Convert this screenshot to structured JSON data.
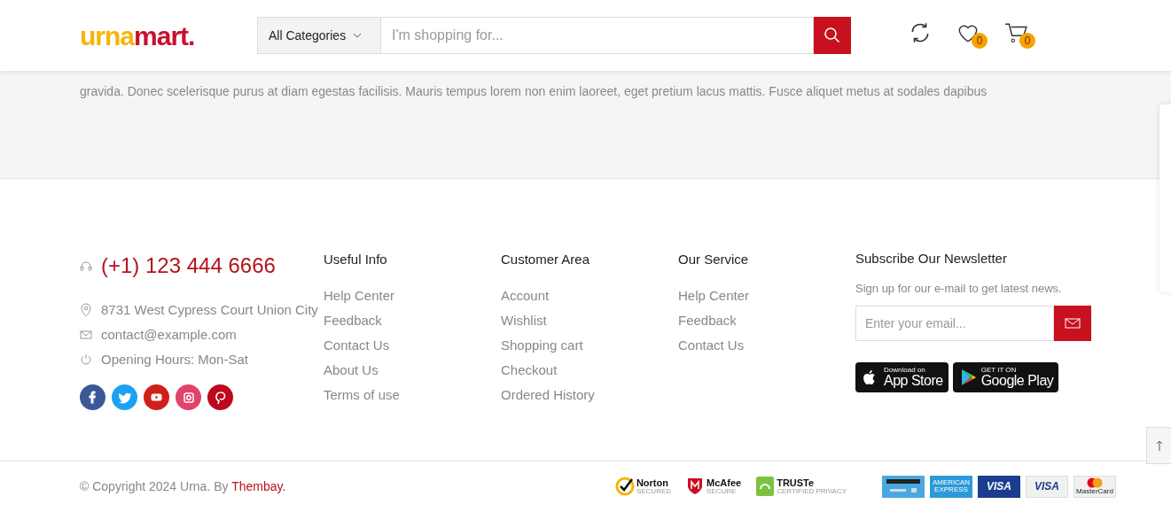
{
  "header": {
    "logo": [
      {
        "text": "urna",
        "color": "#f5b50a"
      },
      {
        "text": "mart.",
        "color": "#c8102e"
      }
    ],
    "category": "All Categories",
    "search_placeholder": "I'm shopping for...",
    "icons": [
      {
        "kind": "compare"
      },
      {
        "kind": "wishlist",
        "badge": "0"
      },
      {
        "kind": "cart",
        "badge": "0"
      }
    ]
  },
  "intro_text": "gravida. Donec scelerisque purus at diam egestas facilisis. Mauris tempus lorem non enim laoreet, eget pretium lacus mattis. Fusce aliquet metus at sodales dapibus",
  "contact": {
    "phone": "(+1) 123 444 6666",
    "items": [
      {
        "kind": "location",
        "text": "8731 West Cypress Court Union City"
      },
      {
        "kind": "mail",
        "text": "contact@example.com"
      },
      {
        "kind": "clock",
        "text": "Opening Hours: Mon-Sat"
      }
    ],
    "social": [
      {
        "kind": "facebook",
        "color": "#3b5998"
      },
      {
        "kind": "twitter",
        "color": "#1da1f2"
      },
      {
        "kind": "youtube",
        "color": "#d0201a"
      },
      {
        "kind": "instagram",
        "color": "#e1436a"
      },
      {
        "kind": "pinterest",
        "color": "#bd081c"
      }
    ]
  },
  "columns": [
    {
      "title": "Useful Info",
      "links": [
        "Help Center",
        "Feedback",
        "Contact Us",
        "About Us",
        "Terms of use"
      ]
    },
    {
      "title": "Customer Area",
      "links": [
        "Account",
        "Wishlist",
        "Shopping cart",
        "Checkout",
        "Ordered History"
      ]
    },
    {
      "title": "Our Service",
      "links": [
        "Help Center",
        "Feedback",
        "Contact Us"
      ]
    }
  ],
  "newsletter": {
    "title": "Subscribe Our Newsletter",
    "text": "Sign up for our e-mail to get latest news.",
    "placeholder": "Enter your email...",
    "apps": [
      {
        "kind": "apple",
        "small": "Download on",
        "big": "App Store"
      },
      {
        "kind": "google",
        "small": "GET IT ON",
        "big": "Google Play"
      }
    ]
  },
  "copyright": {
    "text": "© Copyright 2024 Urna. By ",
    "link": "Thembay."
  },
  "trust_badges": [
    {
      "kind": "norton",
      "title": "Norton",
      "sub": "SECURED"
    },
    {
      "kind": "mcafee",
      "title": "McAfee",
      "sub": "SECURE"
    },
    {
      "kind": "truste",
      "title": "TRUSTe",
      "sub": "CERTIFIED PRIVACY"
    }
  ],
  "payments": [
    {
      "kind": "card"
    },
    {
      "kind": "amex",
      "text": "AMERICAN EXPRESS"
    },
    {
      "kind": "visa_dark",
      "text": "VISA"
    },
    {
      "kind": "visa_light",
      "text": "VISA"
    },
    {
      "kind": "mastercard",
      "text": "MasterCard"
    }
  ]
}
